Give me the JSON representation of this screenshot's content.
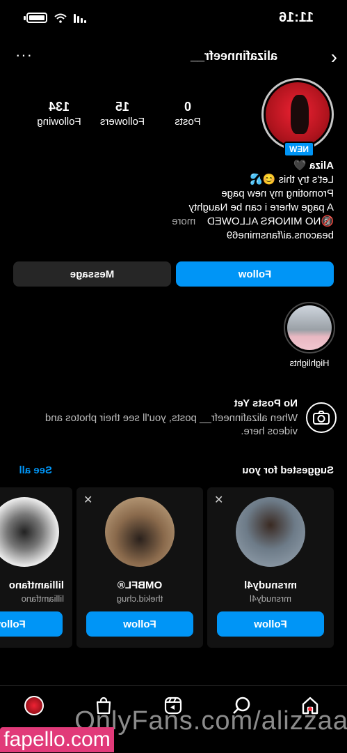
{
  "status_bar": {
    "time": "11:16"
  },
  "header": {
    "username": "alizafinneefr__"
  },
  "profile": {
    "new_badge": "NEW",
    "stats": [
      {
        "value": "0",
        "label": "Posts"
      },
      {
        "value": "15",
        "label": "Followers"
      },
      {
        "value": "134",
        "label": "Following"
      }
    ],
    "bio": {
      "name": "Aliza 🖤",
      "lines": [
        "Let's try this 😊💦",
        "Promoting my new page",
        "A page where i can be Naughty",
        "🔞NO MINORS ALLOWED"
      ],
      "more": "more",
      "link": "beacons.ai/fansmine69"
    },
    "buttons": {
      "follow": "Follow",
      "message": "Message"
    }
  },
  "highlights": [
    {
      "label": "Highlights"
    }
  ],
  "no_posts": {
    "title": "No Posts Yet",
    "text": "When alizafinneefr__ posts, you'll see their photos and videos here."
  },
  "suggested": {
    "title": "Suggested for you",
    "see_all": "See all",
    "cards": [
      {
        "name": "mrsnudy4l",
        "handle": "mrsnudy4l",
        "follow": "Follow",
        "close_icon": "close-icon",
        "pic_color": "#7a8a99"
      },
      {
        "name": "OMBFL®",
        "handle": "thekid.chug",
        "follow": "Follow",
        "close_icon": "close-icon",
        "pic_color": "#b59a7a"
      },
      {
        "name": "lilliamtfano",
        "handle": "lilliamtfano",
        "follow": "Follow",
        "close_icon": "close-icon",
        "pic_color": "#ffffff"
      }
    ]
  },
  "tabbar": {
    "tabs": [
      "home-icon",
      "search-icon",
      "reels-icon",
      "shop-icon",
      "profile-avatar"
    ]
  },
  "watermarks": {
    "onlyfans": "OnlyFans.com/alizzaa",
    "fapello": "fapello.com"
  },
  "colors": {
    "accent": "#0095f6",
    "background": "#000000",
    "card": "#121212",
    "secondary_button": "#262626",
    "notification_dot": "#ff3040"
  }
}
